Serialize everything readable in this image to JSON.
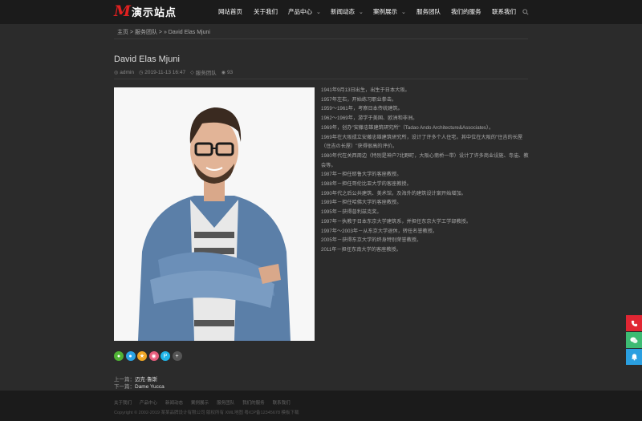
{
  "header": {
    "logo_mark": "M",
    "site_name": "演示站点",
    "nav": [
      {
        "label": "网站首页"
      },
      {
        "label": "关于我们"
      },
      {
        "label": "产品中心",
        "dropdown": true
      },
      {
        "label": "新闻动态",
        "dropdown": true
      },
      {
        "label": "案例展示",
        "dropdown": true
      },
      {
        "label": "服务团队"
      },
      {
        "label": "我们的服务"
      },
      {
        "label": "联系我们"
      }
    ]
  },
  "breadcrumb": {
    "text": "主页 > 服务团队 > » David Elas Mjuni"
  },
  "article": {
    "title": "David Elas Mjuni",
    "author": "admin",
    "date": "2019-11-13 16:47",
    "category": "服务团队",
    "views": "93"
  },
  "bio": [
    "1941年9月13日出生，出生于日本大阪。",
    "1957年左右，开始练习职业拳击。",
    "1959～1961年，考察日本传统建筑。",
    "1962～1969年，游学于美国、欧洲和非洲。",
    "1969年，创办\"安藤忠雄建筑研究所\"（Tadao Ando Architecture&Associates）。",
    "1969年在大阪成立安藤忠雄建筑研究所，设计了许多个人住宅。其中位在大阪的\"住吉的长屋（住吉の长屋）\"获得很高的评价。",
    "1980年代在关西周边（特别是神户7北野町，大阪心斋桥一带）设计了许多商业设施、寺庙、教会等。",
    "1987年－担任耶鲁大学的客座教授。",
    "1988年－担任哥伦比亚大学的客座教授。",
    "1990年代之后公共建筑、美术馆，及海外的建筑设计案开始增加。",
    "1989年－担任哈佛大学的客座教授。",
    "1995年－获得普利兹克奖。",
    "1997年－执教于日本东京大学建筑系，并担任东京大学工学部教授。",
    "1997年～2003年－从东京大学退休，转任名誉教授。",
    "2005年－获得东京大学的终身特别荣誉教授。",
    "2011年－担任东南大学的客座教授。"
  ],
  "share": {
    "icons": [
      "wechat-icon",
      "qq-icon",
      "qzone-icon",
      "weibo-icon",
      "douban-icon",
      "more-icon"
    ],
    "colors": [
      "#50b335",
      "#2ba4e5",
      "#f0a624",
      "#e65c7b",
      "#1fb5e9",
      "#555555"
    ],
    "more_label": "+"
  },
  "prevnext": {
    "prev_label": "上一篇：",
    "prev_title": "迈克·鲁斯",
    "next_label": "下一篇：",
    "next_title": "Dame Yucca"
  },
  "footer": {
    "links": [
      "关于我们",
      "产品中心",
      "新闻动态",
      "案例展示",
      "服务团队",
      "我们的服务",
      "联系我们"
    ],
    "copyright": "Copyright © 2002-2019 某某品牌设计有限公司 版权所有  XML地图  粤ICP备12345678  模板下载"
  },
  "side_buttons": [
    {
      "icon": "phone-icon",
      "color": "#e02633"
    },
    {
      "icon": "wechat-icon",
      "color": "#3dbb73"
    },
    {
      "icon": "bell-icon",
      "color": "#2a9fe0"
    }
  ]
}
